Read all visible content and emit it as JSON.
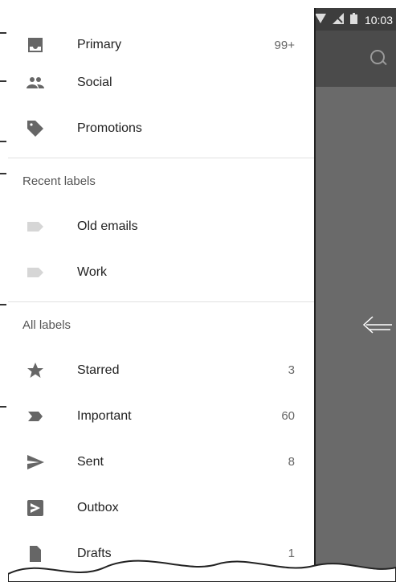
{
  "status_bar": {
    "time": "10:03"
  },
  "drawer": {
    "top_items": [
      {
        "label": "Primary",
        "count": "99+",
        "icon": "inbox-icon"
      },
      {
        "label": "Social",
        "count": "",
        "icon": "people-icon"
      },
      {
        "label": "Promotions",
        "count": "",
        "icon": "tag-icon"
      }
    ],
    "recent_header": "Recent labels",
    "recent_items": [
      {
        "label": "Old emails",
        "icon": "label-icon"
      },
      {
        "label": "Work",
        "icon": "label-icon"
      }
    ],
    "all_header": "All labels",
    "all_items": [
      {
        "label": "Starred",
        "count": "3",
        "icon": "star-icon"
      },
      {
        "label": "Important",
        "count": "60",
        "icon": "important-icon"
      },
      {
        "label": "Sent",
        "count": "8",
        "icon": "send-icon"
      },
      {
        "label": "Outbox",
        "count": "",
        "icon": "outbox-icon"
      },
      {
        "label": "Drafts",
        "count": "1",
        "icon": "draft-icon"
      }
    ]
  },
  "colors": {
    "drawer_bg": "#ffffff",
    "scrim": "#6a6a6a",
    "status_bar": "#3d3d3d"
  }
}
